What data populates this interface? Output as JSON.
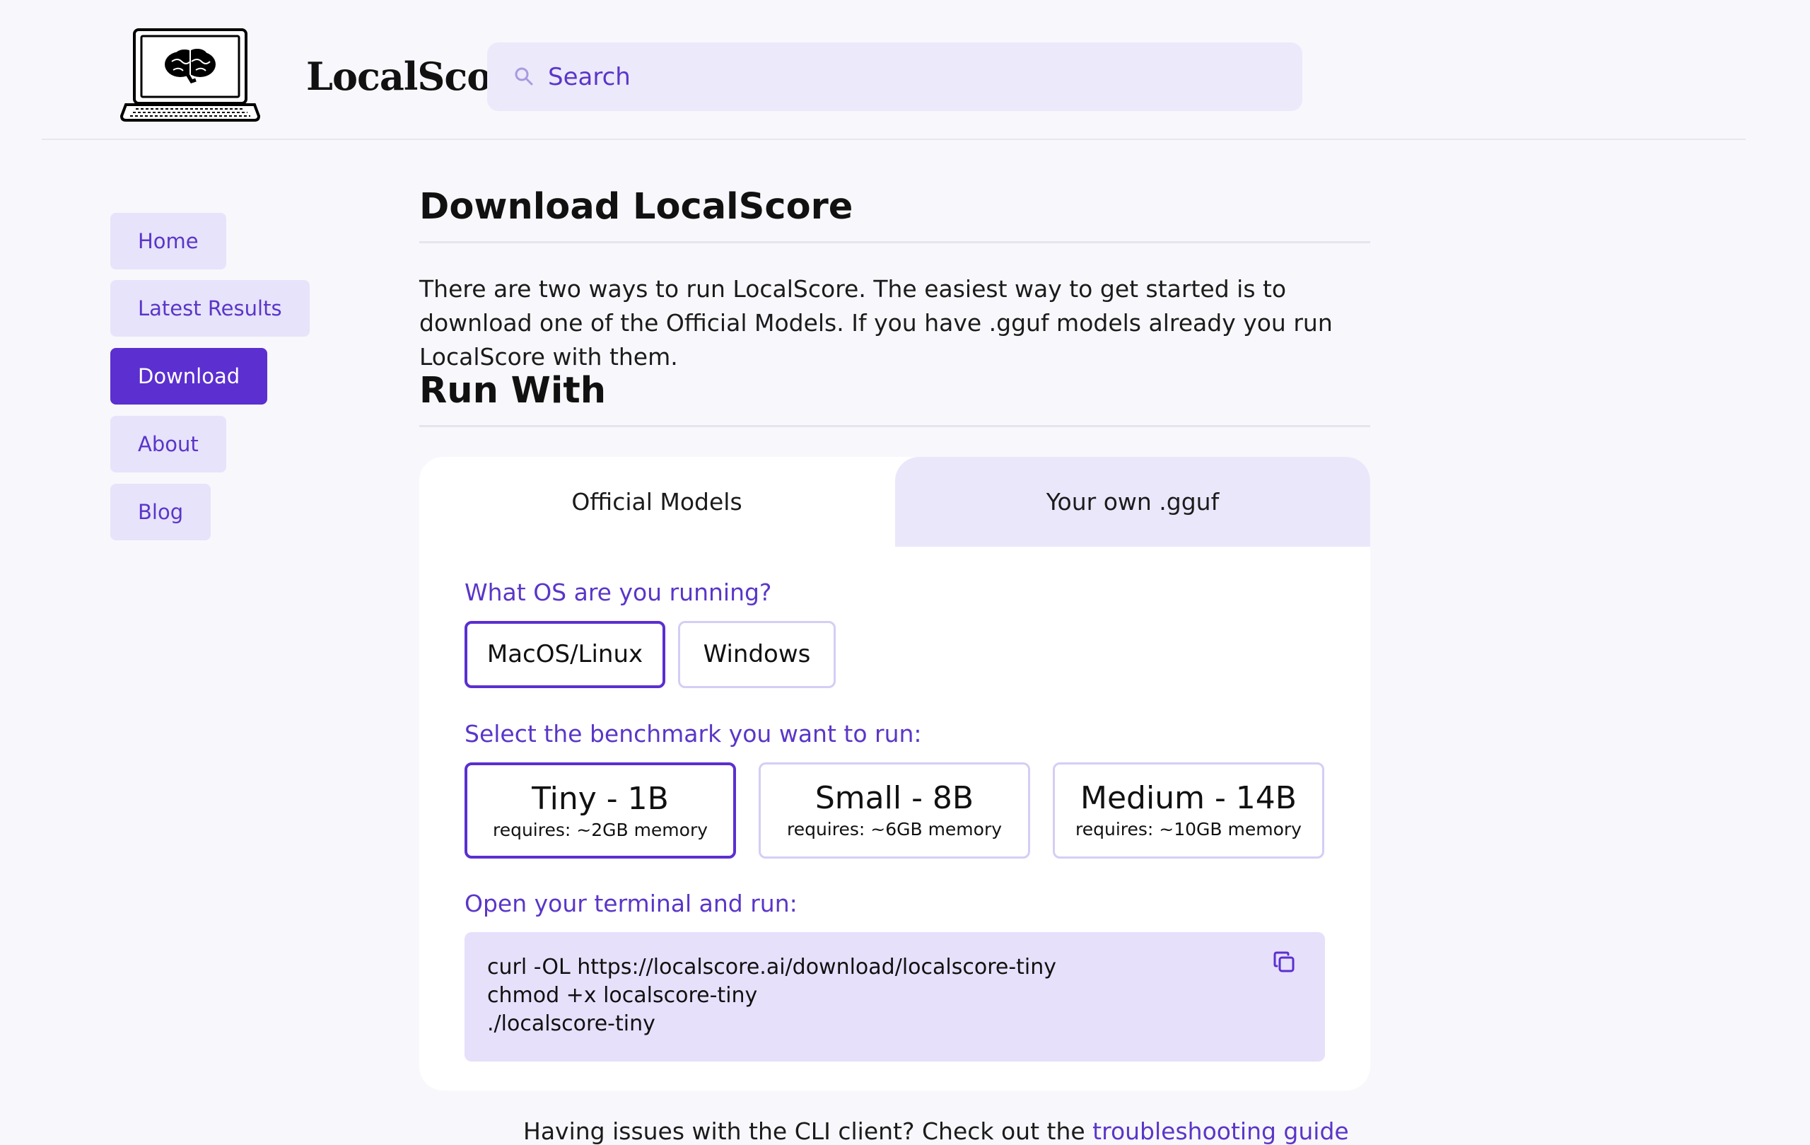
{
  "app": {
    "brand": "LocalScore",
    "logo_icon": "laptop-brain-icon"
  },
  "search": {
    "placeholder": "Search",
    "icon": "search-icon"
  },
  "sidebar": {
    "items": [
      {
        "label": "Home",
        "active": false
      },
      {
        "label": "Latest Results",
        "active": false
      },
      {
        "label": "Download",
        "active": true
      },
      {
        "label": "About",
        "active": false
      },
      {
        "label": "Blog",
        "active": false
      }
    ]
  },
  "main": {
    "title": "Download LocalScore",
    "intro": "There are two ways to run LocalScore. The easiest way to get started is to download one of the Official Models. If you have .gguf models already you run LocalScore with them.",
    "run_with_title": "Run With",
    "tabs": [
      {
        "label": "Official Models",
        "active": true
      },
      {
        "label": "Your own .gguf",
        "active": false
      }
    ],
    "os_question": "What OS are you running?",
    "os_options": [
      {
        "label": "MacOS/Linux",
        "selected": true
      },
      {
        "label": "Windows",
        "selected": false
      }
    ],
    "benchmark_question": "Select the benchmark you want to run:",
    "benchmarks": [
      {
        "title": "Tiny - 1B",
        "requirement": "requires: ~2GB memory",
        "selected": true
      },
      {
        "title": "Small - 8B",
        "requirement": "requires: ~6GB memory",
        "selected": false
      },
      {
        "title": "Medium - 14B",
        "requirement": "requires: ~10GB memory",
        "selected": false
      }
    ],
    "terminal_prompt": "Open your terminal and run:",
    "code_lines": [
      "curl -OL https://localscore.ai/download/localscore-tiny",
      "chmod +x localscore-tiny",
      "./localscore-tiny"
    ],
    "copy_icon": "copy-icon",
    "footer_text": "Having issues with the CLI client? Check out the ",
    "footer_link": "troubleshooting guide"
  },
  "colors": {
    "accent": "#5b2fd0",
    "accent_text": "#5a36c8",
    "soft_purple": "#e7e3fb",
    "code_bg": "#e6e0fb",
    "page_bg": "#f8f7fb"
  }
}
